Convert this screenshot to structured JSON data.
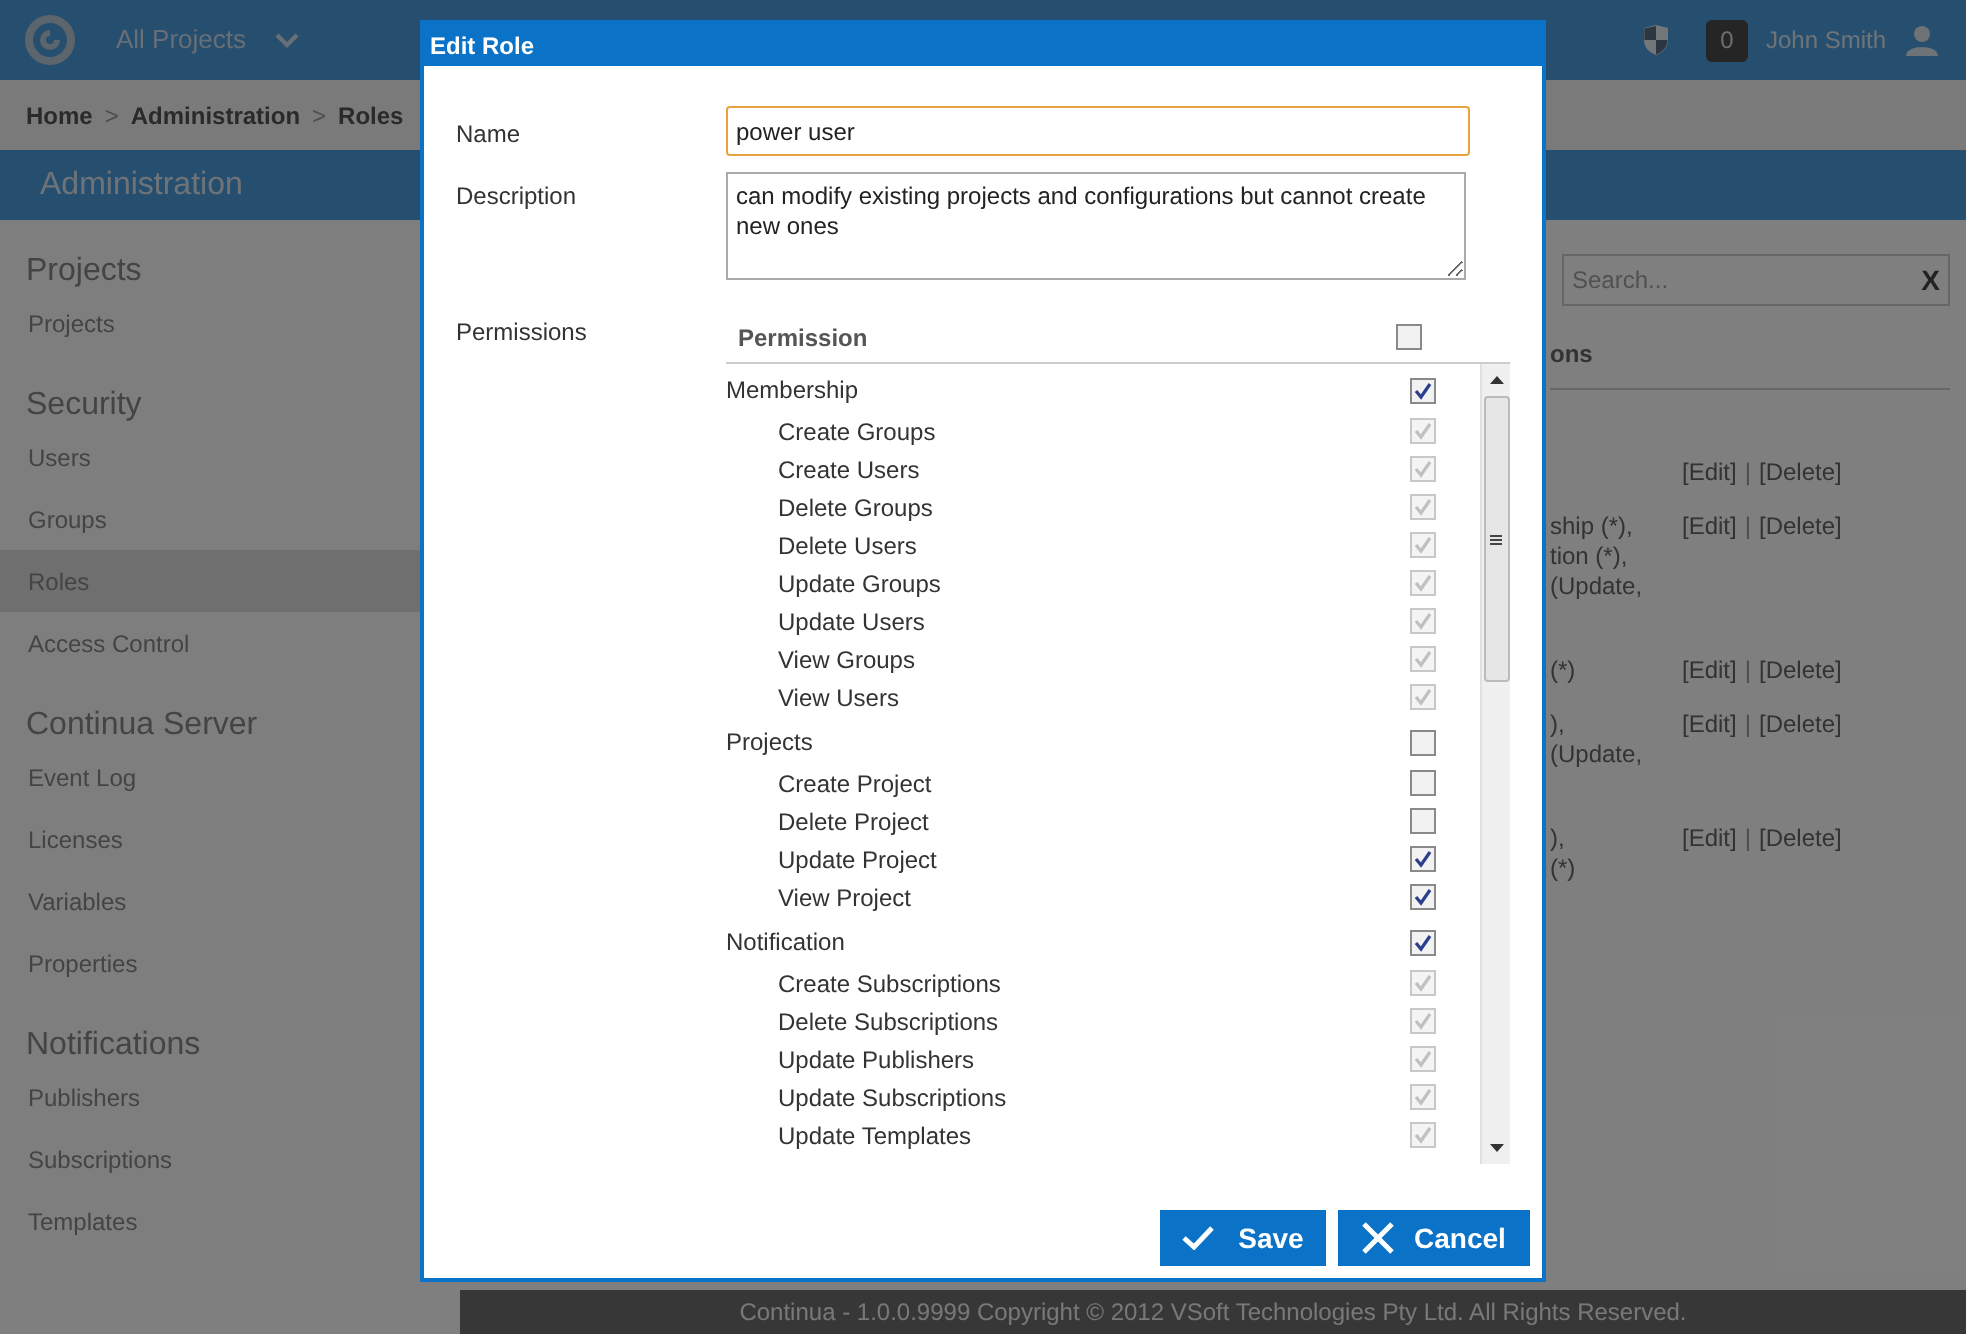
{
  "header": {
    "project_selector": "All Projects",
    "notification_count": "0",
    "user_name": "John Smith"
  },
  "breadcrumb": [
    "Home",
    "Administration",
    "Roles"
  ],
  "breadcrumb_separator": ">",
  "page_title": "Administration",
  "sidebar": [
    {
      "heading": "Projects",
      "items": [
        {
          "label": "Projects",
          "selected": false
        }
      ]
    },
    {
      "heading": "Security",
      "items": [
        {
          "label": "Users",
          "selected": false
        },
        {
          "label": "Groups",
          "selected": false
        },
        {
          "label": "Roles",
          "selected": true
        },
        {
          "label": "Access Control",
          "selected": false
        }
      ]
    },
    {
      "heading": "Continua Server",
      "items": [
        {
          "label": "Event Log",
          "selected": false
        },
        {
          "label": "Licenses",
          "selected": false
        },
        {
          "label": "Variables",
          "selected": false
        },
        {
          "label": "Properties",
          "selected": false
        }
      ]
    },
    {
      "heading": "Notifications",
      "items": [
        {
          "label": "Publishers",
          "selected": false
        },
        {
          "label": "Subscriptions",
          "selected": false
        },
        {
          "label": "Templates",
          "selected": false
        }
      ]
    }
  ],
  "search": {
    "placeholder": "Search...",
    "clear": "X"
  },
  "table": {
    "column_header": "ons",
    "rows": [
      {
        "lines": [],
        "edit": "[Edit]",
        "separator": "|",
        "delete": "[Delete]"
      },
      {
        "lines": [
          "ship (*),",
          "tion (*),",
          "(Update,"
        ],
        "edit": "[Edit]",
        "separator": "|",
        "delete": "[Delete]"
      },
      {
        "lines": [
          "(*)"
        ],
        "edit": "[Edit]",
        "separator": "|",
        "delete": "[Delete]"
      },
      {
        "lines": [
          "),",
          "(Update,"
        ],
        "edit": "[Edit]",
        "separator": "|",
        "delete": "[Delete]"
      },
      {
        "lines": [
          "),",
          "(*)"
        ],
        "edit": "[Edit]",
        "separator": "|",
        "delete": "[Delete]"
      }
    ]
  },
  "footer": "Continua - 1.0.0.9999 Copyright © 2012 VSoft Technologies Pty Ltd. All Rights Reserved.",
  "dialog": {
    "title": "Edit Role",
    "name_label": "Name",
    "name_value": "power user",
    "description_label": "Description",
    "description_value": "can modify existing projects and configurations but cannot create new ones",
    "permissions_label": "Permissions",
    "permission_header": "Permission",
    "all_checked": false,
    "groups": [
      {
        "label": "Membership",
        "checked": true,
        "children": [
          {
            "label": "Create Groups",
            "checked": true,
            "disabled": true
          },
          {
            "label": "Create Users",
            "checked": true,
            "disabled": true
          },
          {
            "label": "Delete Groups",
            "checked": true,
            "disabled": true
          },
          {
            "label": "Delete Users",
            "checked": true,
            "disabled": true
          },
          {
            "label": "Update Groups",
            "checked": true,
            "disabled": true
          },
          {
            "label": "Update Users",
            "checked": true,
            "disabled": true
          },
          {
            "label": "View Groups",
            "checked": true,
            "disabled": true
          },
          {
            "label": "View Users",
            "checked": true,
            "disabled": true
          }
        ]
      },
      {
        "label": "Projects",
        "checked": false,
        "children": [
          {
            "label": "Create Project",
            "checked": false,
            "disabled": false
          },
          {
            "label": "Delete Project",
            "checked": false,
            "disabled": false
          },
          {
            "label": "Update Project",
            "checked": true,
            "disabled": false
          },
          {
            "label": "View Project",
            "checked": true,
            "disabled": false
          }
        ]
      },
      {
        "label": "Notification",
        "checked": true,
        "children": [
          {
            "label": "Create Subscriptions",
            "checked": true,
            "disabled": true
          },
          {
            "label": "Delete Subscriptions",
            "checked": true,
            "disabled": true
          },
          {
            "label": "Update Publishers",
            "checked": true,
            "disabled": true
          },
          {
            "label": "Update Subscriptions",
            "checked": true,
            "disabled": true
          },
          {
            "label": "Update Templates",
            "checked": true,
            "disabled": true
          }
        ]
      }
    ],
    "save": "Save",
    "cancel": "Cancel"
  }
}
